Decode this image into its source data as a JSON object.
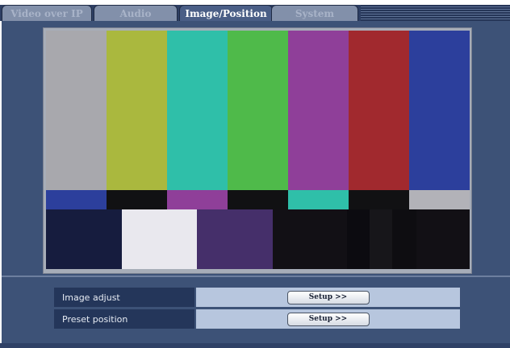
{
  "tabs": [
    {
      "label": "Video over IP",
      "active": false
    },
    {
      "label": "Audio",
      "active": false
    },
    {
      "label": "Image/Position",
      "active": true
    },
    {
      "label": "System",
      "active": false
    }
  ],
  "settings": [
    {
      "label": "Image adjust",
      "button": "Setup >>"
    },
    {
      "label": "Preset position",
      "button": "Setup >>"
    }
  ],
  "colors": {
    "panel": "#3d5277",
    "main_bars": [
      "#a8a8ad",
      "#aab83e",
      "#2fbfa9",
      "#4fba4a",
      "#8f3f99",
      "#a1292e",
      "#2c3f9c"
    ],
    "mid_bars": [
      "#2c3f9c",
      "#111113",
      "#8f3f99",
      "#111113",
      "#2fbfa9",
      "#111113",
      "#b2b2b8"
    ],
    "bottom_blocks": [
      "#161c3e",
      "#e9e8ee",
      "#452f6a",
      "#121015",
      "#121015",
      "#0c0b10",
      "#17161a",
      "#0e0d11",
      "#121015"
    ]
  }
}
